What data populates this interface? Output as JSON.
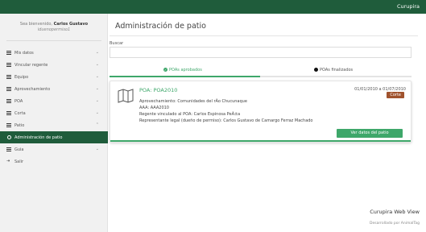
{
  "topbar": {
    "brand": "Curupira"
  },
  "sidebar": {
    "welcome_prefix": "Sea bienvenido,",
    "user_name": "Carlos Gustavo",
    "username": "iduenopermiso1",
    "items": [
      {
        "label": "Mis datos",
        "icon": "menu-icon",
        "chevron": "⌄"
      },
      {
        "label": "Vincular regente",
        "icon": "menu-icon",
        "chevron": "⌄"
      },
      {
        "label": "Equipo",
        "icon": "menu-icon",
        "chevron": "⌄"
      },
      {
        "label": "Aprovechamiento",
        "icon": "menu-icon",
        "chevron": "⌄"
      },
      {
        "label": "POA",
        "icon": "menu-icon",
        "chevron": "⌄"
      },
      {
        "label": "Corta",
        "icon": "menu-icon",
        "chevron": "⌄"
      },
      {
        "label": "Patio",
        "icon": "menu-icon",
        "chevron": "⌃"
      },
      {
        "label": "Administración de patio",
        "icon": "circle-icon",
        "active": true
      },
      {
        "label": "Guia",
        "icon": "menu-icon",
        "chevron": "⌄"
      },
      {
        "label": "Salir",
        "icon": "exit-icon"
      }
    ]
  },
  "main": {
    "title": "Administración de patio",
    "search": {
      "label": "Buscar",
      "value": ""
    },
    "tabs": [
      {
        "label": "POAs aprobados",
        "active": true
      },
      {
        "label": "POAs finalizados",
        "active": false
      }
    ],
    "card": {
      "title": "POA: POA2010",
      "dates": "01/01/2010 a 01/07/2010",
      "badge": "Corte",
      "fields": [
        "Aprovechamiento: Comunidades del rÃo Chucunaque",
        "AAA: AAA2010",
        "Regente vinculado al POA: Carlos Espinosa PeÃ±a",
        "Representante legal (dueño de permiso): Carlos Gustavo de Camargo Ferraz Machado"
      ],
      "button": "Ver datos del patio"
    }
  },
  "footer": {
    "title": "Curupira Web View",
    "subtitle": "Desarrollado por AnimalTag"
  },
  "colors": {
    "topbar": "#1f5c3b",
    "accent": "#3ea76a",
    "badge": "#a0522d"
  }
}
